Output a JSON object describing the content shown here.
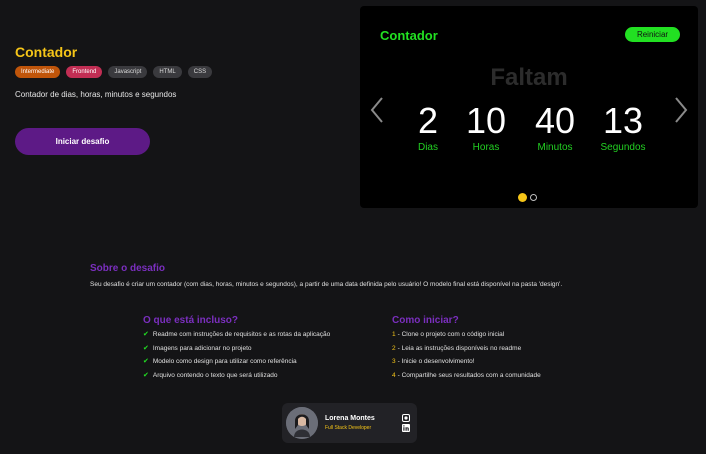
{
  "challenge": {
    "title": "Contador",
    "tags": [
      "Intermediate",
      "Frontend",
      "Javascript",
      "HTML",
      "CSS"
    ],
    "description": "Contador de dias, horas, minutos e segundos",
    "start_label": "Iniciar desafio"
  },
  "preview": {
    "title": "Contador",
    "restart_label": "Reiniciar",
    "heading": "Faltam",
    "units": [
      {
        "value": "2",
        "label": "Dias"
      },
      {
        "value": "10",
        "label": "Horas"
      },
      {
        "value": "40",
        "label": "Minutos"
      },
      {
        "value": "13",
        "label": "Segundos"
      }
    ],
    "active_slide": 1,
    "slide_count": 2
  },
  "about": {
    "title": "Sobre o desafio",
    "text": "Seu desafio é criar um contador (com dias, horas, minutos e segundos), a partir de uma data definida pelo usuário! O modelo final está disponível na pasta 'design'."
  },
  "included": {
    "title": "O que está incluso?",
    "items": [
      "Readme com instruções de requisitos e as rotas da aplicação",
      "Imagens para adicionar no projeto",
      "Modelo como design para utilizar como referência",
      "Arquivo contendo o texto que será utilizado"
    ]
  },
  "howto": {
    "title": "Como iniciar?",
    "steps": [
      {
        "n": "1",
        "text": "- Clone o projeto com o código inicial"
      },
      {
        "n": "2",
        "text": "- Leia as instruções disponíveis no readme"
      },
      {
        "n": "3",
        "text": "- Inicie o desenvolvimento!"
      },
      {
        "n": "4",
        "text": "- Compartilhe seus resultados com a comunidade"
      }
    ]
  },
  "author": {
    "name": "Lorena Montes",
    "role": "Full Stack Developer"
  },
  "colors": {
    "accent_yellow": "#f5c518",
    "accent_green": "#22e022",
    "accent_purple": "#7b2fbf",
    "button_purple": "#5d1a86",
    "background": "#141416"
  },
  "icons": [
    "chevron-left-icon",
    "chevron-right-icon",
    "check-icon",
    "github-icon",
    "linkedin-icon"
  ]
}
